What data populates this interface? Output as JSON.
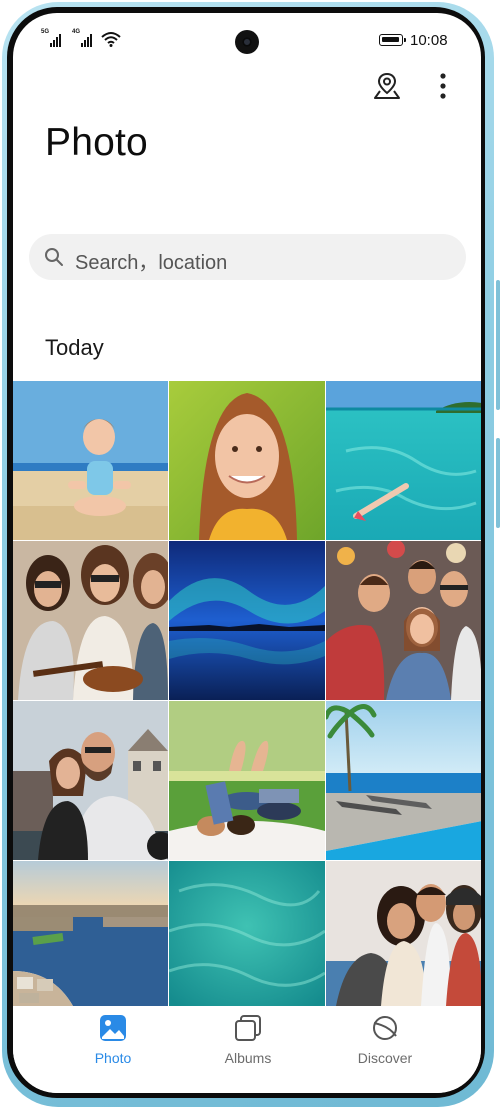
{
  "status_bar": {
    "signal_1_tag": "5G",
    "signal_2_tag": "4G",
    "time": "10:08"
  },
  "header": {
    "actions": [
      {
        "icon": "map-pin-icon"
      },
      {
        "icon": "more-vertical-icon"
      }
    ],
    "title": "Photo"
  },
  "search": {
    "placeholder": "Search，location",
    "icon": "search-icon"
  },
  "gallery": {
    "section_title": "Today",
    "photos": [
      {
        "subject": "toddler-on-beach"
      },
      {
        "subject": "smiling-woman-portrait"
      },
      {
        "subject": "swimmer-tropical-sea"
      },
      {
        "subject": "friends-with-guitar"
      },
      {
        "subject": "aurora-over-lake"
      },
      {
        "subject": "group-selfie"
      },
      {
        "subject": "couple-selfie-city"
      },
      {
        "subject": "couple-lying-on-grass"
      },
      {
        "subject": "poolside-loungers"
      },
      {
        "subject": "riverside-city-aerial"
      },
      {
        "subject": "turquoise-water"
      },
      {
        "subject": "friends-group-photo"
      }
    ]
  },
  "bottom_nav": {
    "items": [
      {
        "label": "Photo",
        "icon": "photo-icon",
        "active": true
      },
      {
        "label": "Albums",
        "icon": "albums-icon",
        "active": false
      },
      {
        "label": "Discover",
        "icon": "discover-icon",
        "active": false
      }
    ]
  },
  "colors": {
    "accent": "#2a8ae6",
    "frame": "#8dcde3",
    "search_bg": "#f1f1f1"
  }
}
